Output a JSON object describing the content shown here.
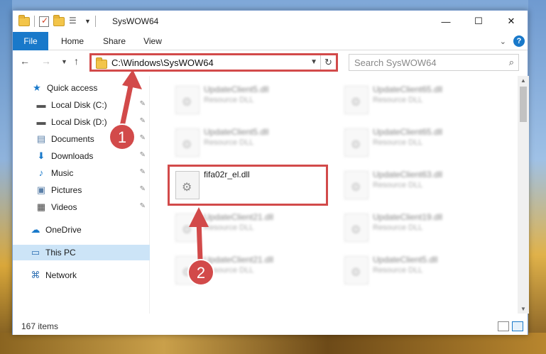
{
  "window": {
    "title": "SysWOW64"
  },
  "window_buttons": {
    "minimize": "—",
    "maximize": "☐",
    "close": "✕"
  },
  "ribbon": {
    "tabs": [
      {
        "label": "File",
        "active": true
      },
      {
        "label": "Home"
      },
      {
        "label": "Share"
      },
      {
        "label": "View"
      }
    ],
    "expand_icon": "chevron-down-icon",
    "help_icon": "help-icon",
    "help_label": "?"
  },
  "nav": {
    "address": "C:\\Windows\\SysWOW64",
    "search_placeholder": "Search SysWOW64"
  },
  "sidebar": {
    "items": [
      {
        "label": "Quick access",
        "icon": "star-icon",
        "glyph": "★",
        "color": "#1979ca",
        "pinned": false
      },
      {
        "label": "Local Disk (C:)",
        "icon": "drive-icon",
        "glyph": "▬",
        "color": "#555555",
        "pinned": true
      },
      {
        "label": "Local Disk (D:)",
        "icon": "drive-icon",
        "glyph": "▬",
        "color": "#555555",
        "pinned": true
      },
      {
        "label": "Documents",
        "icon": "documents-icon",
        "glyph": "▤",
        "color": "#5a7fa8",
        "pinned": true
      },
      {
        "label": "Downloads",
        "icon": "download-icon",
        "glyph": "⬇",
        "color": "#1979ca",
        "pinned": true
      },
      {
        "label": "Music",
        "icon": "music-icon",
        "glyph": "♪",
        "color": "#1979ca",
        "pinned": true
      },
      {
        "label": "Pictures",
        "icon": "pictures-icon",
        "glyph": "▣",
        "color": "#5a7fa8",
        "pinned": true
      },
      {
        "label": "Videos",
        "icon": "videos-icon",
        "glyph": "▦",
        "color": "#444444",
        "pinned": true
      },
      {
        "label": "OneDrive",
        "icon": "cloud-icon",
        "glyph": "☁",
        "color": "#1979ca",
        "pinned": false
      },
      {
        "label": "This PC",
        "icon": "computer-icon",
        "glyph": "▭",
        "color": "#2d6fb3",
        "pinned": false,
        "active": true
      },
      {
        "label": "Network",
        "icon": "network-icon",
        "glyph": "⌘",
        "color": "#2d6fb3",
        "pinned": false
      }
    ]
  },
  "files": [
    {
      "name": "UpdateClient5.dll",
      "type": "Resource DLL",
      "blurred": true
    },
    {
      "name": "UpdateClient65.dll",
      "type": "Resource DLL",
      "blurred": true
    },
    {
      "name": "UpdateClient5.dll",
      "type": "Resource DLL",
      "blurred": true
    },
    {
      "name": "UpdateClient65.dll",
      "type": "Resource DLL",
      "blurred": true
    },
    {
      "name": "fifa02r_el.dll",
      "type": "",
      "blurred": false
    },
    {
      "name": "UpdateClient63.dll",
      "type": "Resource DLL",
      "blurred": true
    },
    {
      "name": "UpdateClient21.dll",
      "type": "Resource DLL",
      "blurred": true
    },
    {
      "name": "UpdateClient19.dll",
      "type": "Resource DLL",
      "blurred": true
    },
    {
      "name": "UpdateClient21.dll",
      "type": "Resource DLL",
      "blurred": true
    },
    {
      "name": "UpdateClient5.dll",
      "type": "Resource DLL",
      "blurred": true
    }
  ],
  "status": {
    "item_count": "167 items"
  },
  "annotations": [
    {
      "number": "1",
      "color": "#d24a4a"
    },
    {
      "number": "2",
      "color": "#d24a4a"
    }
  ]
}
